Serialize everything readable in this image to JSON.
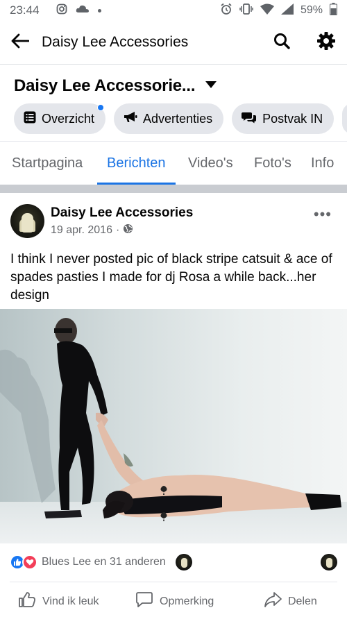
{
  "status_bar": {
    "time": "23:44",
    "battery": "59%"
  },
  "header": {
    "title": "Daisy Lee Accessories"
  },
  "page": {
    "name": "Daisy Lee Accessorie...",
    "pills": [
      {
        "label": "Overzicht",
        "icon": "list-icon",
        "badge": true
      },
      {
        "label": "Advertenties",
        "icon": "megaphone-icon",
        "badge": false
      },
      {
        "label": "Postvak IN",
        "icon": "chat-bubbles-icon",
        "badge": false
      }
    ],
    "tabs": [
      "Startpagina",
      "Berichten",
      "Video's",
      "Foto's",
      "Info"
    ],
    "active_tab": "Berichten"
  },
  "post": {
    "author": "Daisy Lee Accessories",
    "date": "19 apr. 2016",
    "separator": "·",
    "text": "I think I never posted pic of black stripe catsuit & ace of spades pasties I made for dj Rosa a while back...her design",
    "reactions_text": "Blues Lee en 31 anderen",
    "actions": {
      "like": "Vind ik leuk",
      "comment": "Opmerking",
      "share": "Delen"
    }
  },
  "colors": {
    "accent": "#1b74e4",
    "like": "#1877f2",
    "love": "#f33e58"
  }
}
